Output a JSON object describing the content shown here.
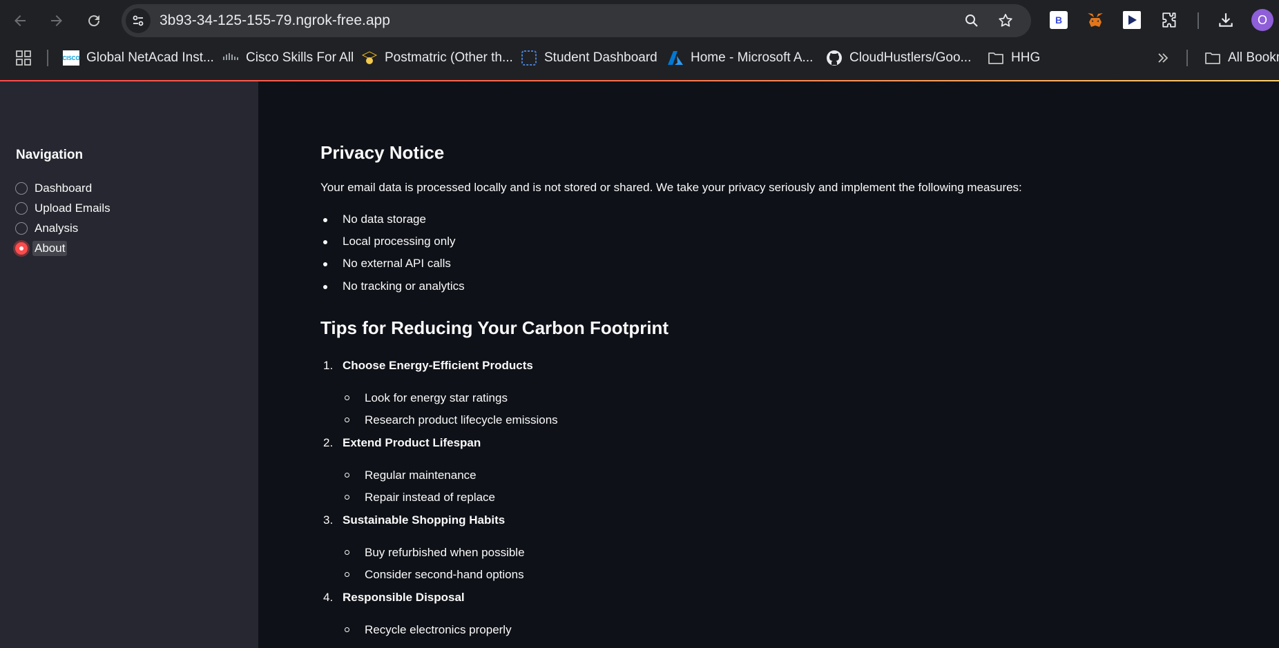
{
  "browser": {
    "url": "3b93-34-125-155-79.ngrok-free.app",
    "profile_initial": "O",
    "bookmarks": [
      {
        "label": "Global NetAcad Inst...",
        "icon": "cisco-icon"
      },
      {
        "label": "Cisco Skills For All",
        "icon": "cisco-icon"
      },
      {
        "label": "Postmatric (Other th...",
        "icon": "graduate-icon"
      },
      {
        "label": "Student Dashboard",
        "icon": "dashboard-icon"
      },
      {
        "label": "Home - Microsoft A...",
        "icon": "azure-icon"
      },
      {
        "label": "CloudHustlers/Goo...",
        "icon": "github-icon"
      },
      {
        "label": "HHG",
        "icon": "folder-icon"
      }
    ],
    "all_bookmarks_label": "All Bookm"
  },
  "sidebar": {
    "title": "Navigation",
    "items": [
      {
        "label": "Dashboard",
        "selected": false
      },
      {
        "label": "Upload Emails",
        "selected": false
      },
      {
        "label": "Analysis",
        "selected": false
      },
      {
        "label": "About",
        "selected": true
      }
    ]
  },
  "privacy": {
    "heading": "Privacy Notice",
    "intro": "Your email data is processed locally and is not stored or shared. We take your privacy seriously and implement the following measures:",
    "measures": [
      "No data storage",
      "Local processing only",
      "No external API calls",
      "No tracking or analytics"
    ]
  },
  "tips": {
    "heading": "Tips for Reducing Your Carbon Footprint",
    "items": [
      {
        "number": "1.",
        "title": "Choose Energy-Efficient Products",
        "points": [
          "Look for energy star ratings",
          "Research product lifecycle emissions"
        ]
      },
      {
        "number": "2.",
        "title": "Extend Product Lifespan",
        "points": [
          "Regular maintenance",
          "Repair instead of replace"
        ]
      },
      {
        "number": "3.",
        "title": "Sustainable Shopping Habits",
        "points": [
          "Buy refurbished when possible",
          "Consider second-hand options"
        ]
      },
      {
        "number": "4.",
        "title": "Responsible Disposal",
        "points": [
          "Recycle electronics properly"
        ]
      }
    ]
  },
  "colors": {
    "accent": "#ff4b4b",
    "sidebar_bg": "#262730",
    "main_bg": "#0e1117"
  }
}
